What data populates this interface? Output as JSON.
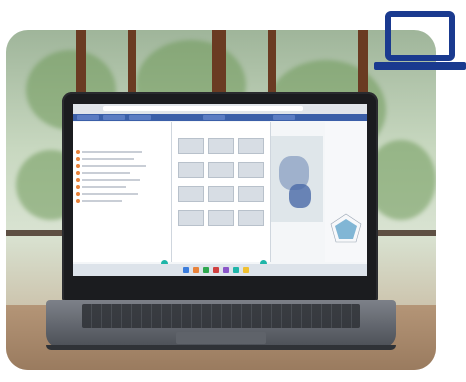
{
  "scene": {
    "subject": "",
    "icon": "laptop-icon",
    "colors": {
      "icon_blue": "#1a3a8f",
      "accent_orange": "#e8823a",
      "accent_teal": "#1fb5a8",
      "tab_blue": "#3b5fa8"
    }
  },
  "screen": {
    "left_panel_title": "",
    "middle_panel_title": "",
    "right_panel_title": ""
  }
}
